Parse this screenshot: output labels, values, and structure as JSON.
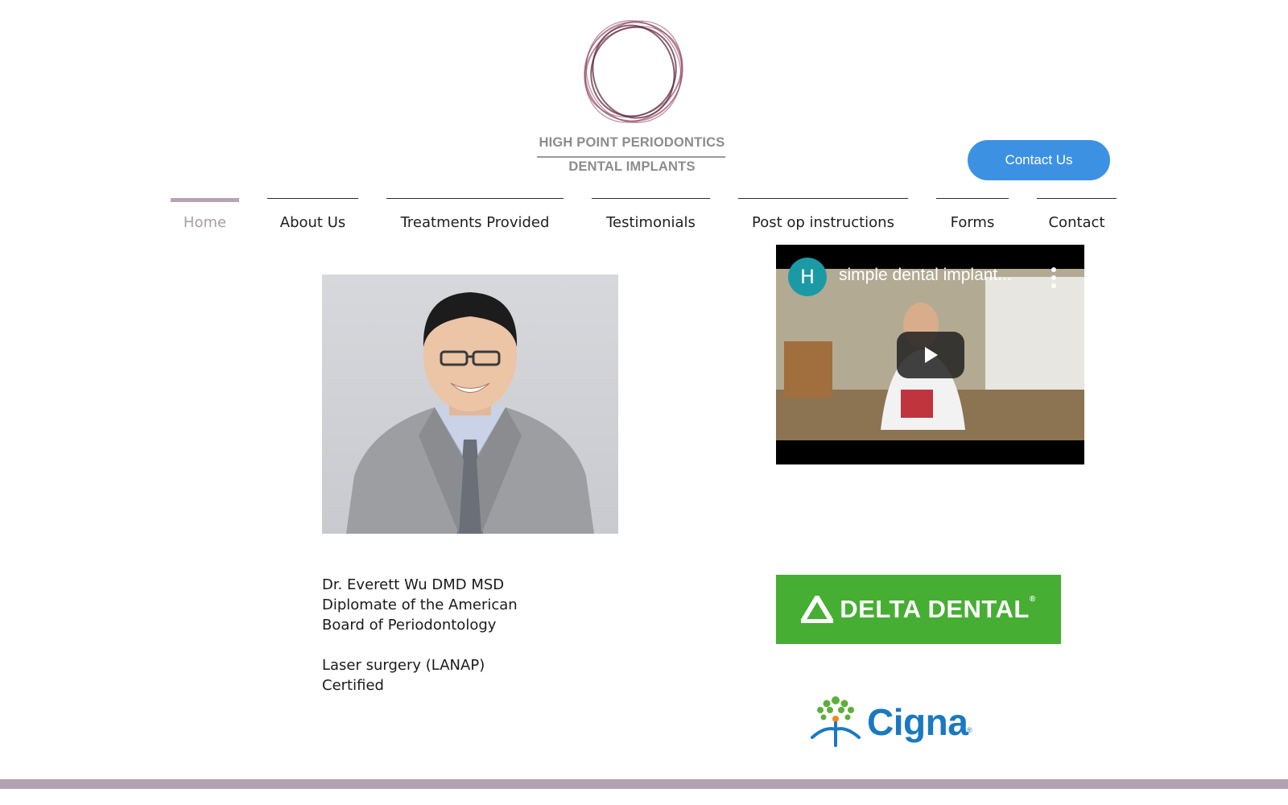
{
  "header": {
    "logo_line1": "HIGH POINT PERIODONTICS",
    "logo_line2": "DENTAL IMPLANTS",
    "contact_button": "Contact Us"
  },
  "nav": {
    "items": [
      {
        "label": "Home",
        "active": true
      },
      {
        "label": "About Us"
      },
      {
        "label": "Treatments Provided"
      },
      {
        "label": "Testimonials"
      },
      {
        "label": "Post op instructions"
      },
      {
        "label": "Forms"
      },
      {
        "label": "Contact"
      }
    ]
  },
  "bio": {
    "line1": "Dr. Everett Wu DMD MSD",
    "line2": "Diplomate of the American",
    "line3": "Board of Periodontology",
    "line4": "Laser surgery (LANAP)",
    "line5": "Certified"
  },
  "video": {
    "channel_initial": "H",
    "title": "simple dental implant..."
  },
  "insurance": {
    "delta": "DELTA DENTAL",
    "delta_mark": "®",
    "cigna": "Cigna",
    "cigna_mark": "®"
  },
  "colors": {
    "accent": "#b3a2b1",
    "button": "#3d91e2",
    "delta_green": "#46ae33",
    "cigna_blue": "#1a79c2"
  }
}
